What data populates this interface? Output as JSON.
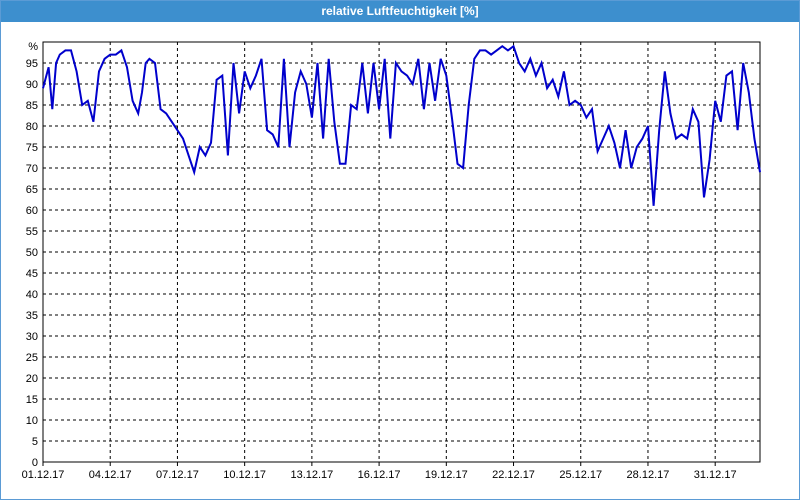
{
  "window": {
    "title": "relative Luftfeuchtigkeit [%]"
  },
  "colors": {
    "title_bar": "#3d8fce",
    "series": "#0000cc",
    "grid": "#000000"
  },
  "chart_data": {
    "type": "line",
    "title": "relative Luftfeuchtigkeit [%]",
    "ylabel": "%",
    "xlabel": "",
    "ylim": [
      0,
      100
    ],
    "xlim": [
      "2017-12-01",
      "2018-01-02"
    ],
    "grid": true,
    "yticks": [
      "0",
      "5",
      "10",
      "15",
      "20",
      "25",
      "30",
      "35",
      "40",
      "45",
      "50",
      "55",
      "60",
      "65",
      "70",
      "75",
      "80",
      "85",
      "90",
      "95"
    ],
    "xticks": [
      "01.12.17",
      "04.12.17",
      "07.12.17",
      "10.12.17",
      "13.12.17",
      "16.12.17",
      "19.12.17",
      "22.12.17",
      "25.12.17",
      "28.12.17",
      "31.12.17"
    ],
    "series": [
      {
        "x": [
          "2017-12-01",
          "2017-12-01 06:00",
          "2017-12-01 10:00",
          "2017-12-01 14:00",
          "2017-12-01 18:00",
          "2017-12-02 00:00",
          "2017-12-02 06:00",
          "2017-12-02 12:00",
          "2017-12-02 18:00",
          "2017-12-03 00:00",
          "2017-12-03 06:00",
          "2017-12-03 12:00",
          "2017-12-03 18:00",
          "2017-12-04 00:00",
          "2017-12-04 06:00",
          "2017-12-04 12:00",
          "2017-12-04 18:00",
          "2017-12-05 00:00",
          "2017-12-05 06:00",
          "2017-12-05 10:00",
          "2017-12-05 14:00",
          "2017-12-05 18:00",
          "2017-12-06 00:00",
          "2017-12-06 06:00",
          "2017-12-06 12:00",
          "2017-12-06 18:00",
          "2017-12-07 00:00",
          "2017-12-07 06:00",
          "2017-12-07 12:00",
          "2017-12-07 18:00",
          "2017-12-08 00:00",
          "2017-12-08 06:00",
          "2017-12-08 12:00",
          "2017-12-08 18:00",
          "2017-12-09 00:00",
          "2017-12-09 06:00",
          "2017-12-09 12:00",
          "2017-12-09 18:00",
          "2017-12-10 00:00",
          "2017-12-10 06:00",
          "2017-12-10 12:00",
          "2017-12-10 18:00",
          "2017-12-11 00:00",
          "2017-12-11 06:00",
          "2017-12-11 12:00",
          "2017-12-11 18:00",
          "2017-12-12 00:00",
          "2017-12-12 06:00",
          "2017-12-12 12:00",
          "2017-12-12 18:00",
          "2017-12-13 00:00",
          "2017-12-13 06:00",
          "2017-12-13 12:00",
          "2017-12-13 18:00",
          "2017-12-14 00:00",
          "2017-12-14 06:00",
          "2017-12-14 12:00",
          "2017-12-14 18:00",
          "2017-12-15 00:00",
          "2017-12-15 06:00",
          "2017-12-15 12:00",
          "2017-12-15 18:00",
          "2017-12-16 00:00",
          "2017-12-16 06:00",
          "2017-12-16 12:00",
          "2017-12-16 18:00",
          "2017-12-17 00:00",
          "2017-12-17 06:00",
          "2017-12-17 12:00",
          "2017-12-17 18:00",
          "2017-12-18 00:00",
          "2017-12-18 06:00",
          "2017-12-18 12:00",
          "2017-12-18 18:00",
          "2017-12-19 00:00",
          "2017-12-19 06:00",
          "2017-12-19 12:00",
          "2017-12-19 18:00",
          "2017-12-20 00:00",
          "2017-12-20 06:00",
          "2017-12-20 12:00",
          "2017-12-20 18:00",
          "2017-12-21 00:00",
          "2017-12-21 06:00",
          "2017-12-21 12:00",
          "2017-12-21 18:00",
          "2017-12-22 00:00",
          "2017-12-22 06:00",
          "2017-12-22 12:00",
          "2017-12-22 18:00",
          "2017-12-23 00:00",
          "2017-12-23 06:00",
          "2017-12-23 12:00",
          "2017-12-23 18:00",
          "2017-12-24 00:00",
          "2017-12-24 06:00",
          "2017-12-24 12:00",
          "2017-12-24 18:00",
          "2017-12-25 00:00",
          "2017-12-25 06:00",
          "2017-12-25 12:00",
          "2017-12-25 18:00",
          "2017-12-26 00:00",
          "2017-12-26 06:00",
          "2017-12-26 12:00",
          "2017-12-26 18:00",
          "2017-12-27 00:00",
          "2017-12-27 06:00",
          "2017-12-27 12:00",
          "2017-12-27 18:00",
          "2017-12-28 00:00",
          "2017-12-28 06:00",
          "2017-12-28 12:00",
          "2017-12-28 18:00",
          "2017-12-29 00:00",
          "2017-12-29 06:00",
          "2017-12-29 12:00",
          "2017-12-29 18:00",
          "2017-12-30 00:00",
          "2017-12-30 06:00",
          "2017-12-30 12:00",
          "2017-12-30 18:00",
          "2017-12-31 00:00",
          "2017-12-31 06:00",
          "2017-12-31 12:00",
          "2017-12-31 18:00",
          "2018-01-01 00:00",
          "2018-01-01 06:00",
          "2018-01-01 12:00",
          "2018-01-01 18:00",
          "2018-01-02 00:00"
        ],
        "values": [
          89,
          94,
          84,
          95,
          97,
          98,
          98,
          93,
          85,
          86,
          81,
          93,
          96,
          97,
          97,
          98,
          94,
          86,
          83,
          88,
          95,
          96,
          95,
          84,
          83,
          81,
          79,
          77,
          73,
          69,
          75,
          73,
          76,
          91,
          92,
          73,
          95,
          83,
          93,
          89,
          92,
          96,
          79,
          78,
          75,
          96,
          75,
          88,
          93,
          90,
          82,
          95,
          77,
          96,
          81,
          71,
          71,
          85,
          84,
          95,
          83,
          95,
          84,
          96,
          77,
          95,
          93,
          92,
          90,
          96,
          84,
          95,
          86,
          96,
          92,
          82,
          71,
          70,
          85,
          96,
          98,
          98,
          97,
          98,
          99,
          98,
          99,
          95,
          93,
          96,
          92,
          95,
          89,
          91,
          87,
          93,
          85,
          86,
          85,
          82,
          84,
          74,
          77,
          80,
          76,
          70,
          79,
          70,
          75,
          77,
          80,
          61,
          79,
          93,
          83,
          77,
          78,
          77,
          84,
          81,
          63,
          72,
          86,
          81,
          92,
          93,
          79,
          95,
          88,
          77,
          69
        ]
      }
    ]
  }
}
